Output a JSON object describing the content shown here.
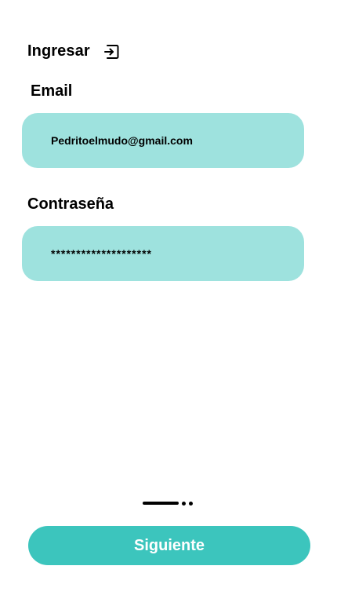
{
  "header": {
    "title": "Ingresar",
    "icon": "login-icon"
  },
  "form": {
    "email_label": "Email",
    "email_value": "Pedritoelmudo@gmail.com",
    "password_label": "Contraseña",
    "password_value": "********************"
  },
  "pager": {
    "total_pages": 3,
    "current_page": 1
  },
  "actions": {
    "next_label": "Siguiente"
  },
  "colors": {
    "field_background": "#9ee2de",
    "button_background": "#3cc5bd",
    "button_text": "#ffffff",
    "text": "#000000"
  }
}
